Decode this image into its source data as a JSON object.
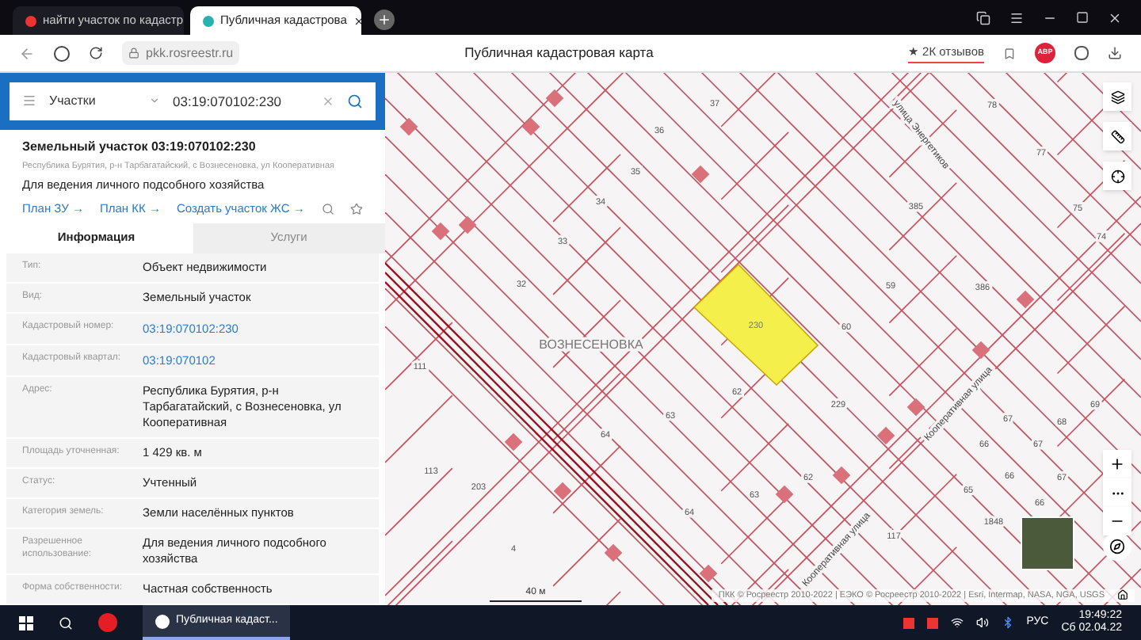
{
  "browser": {
    "tabs": [
      {
        "title": "найти участок по кадастр",
        "selected": false
      },
      {
        "title": "Публичная кадастрова",
        "selected": true
      }
    ],
    "url": "pkk.rosreestr.ru",
    "page_title": "Публичная кадастровая карта",
    "reviews": "★ 2К отзывов",
    "adblock": "ABP"
  },
  "search": {
    "category": "Участки",
    "value": "03:19:070102:230"
  },
  "object": {
    "title": "Земельный участок 03:19:070102:230",
    "address": "Республика Бурятия, р-н Тарбагатайский, с Вознесеновка, ул Кооперативная",
    "purpose": "Для ведения личного подсобного хозяйства",
    "links": [
      "План ЗУ →",
      "План КК →",
      "Создать участок ЖС →"
    ]
  },
  "info_tabs": [
    {
      "label": "Информация",
      "selected": true
    },
    {
      "label": "Услуги",
      "selected": false
    }
  ],
  "rows": [
    {
      "label": "Тип:",
      "value": "Объект недвижимости",
      "kind": "text"
    },
    {
      "label": "Вид:",
      "value": "Земельный участок",
      "kind": "text"
    },
    {
      "label": "Кадастровый номер:",
      "value": "03:19:070102:230",
      "kind": "link"
    },
    {
      "label": "Кадастровый квартал:",
      "value": "03:19:070102",
      "kind": "link"
    },
    {
      "label": "Адрес:",
      "value": "Республика Бурятия, р-н Тарбагатайский, с Вознесеновка, ул Кооперативная",
      "kind": "text"
    },
    {
      "label": "Площадь уточненная:",
      "value": "1 429 кв. м",
      "kind": "text"
    },
    {
      "label": "Статус:",
      "value": "Учтенный",
      "kind": "text"
    },
    {
      "label": "Категория земель:",
      "value": "Земли населённых пунктов",
      "kind": "text"
    },
    {
      "label": "Разрешенное использование:",
      "value": "Для ведения личного подсобного хозяйства",
      "kind": "text"
    },
    {
      "label": "Форма собственности:",
      "value": "Частная собственность",
      "kind": "text"
    }
  ],
  "map": {
    "village": "ВОЗНЕСЕНОВКА",
    "selected_parcel": "230",
    "parcels": [
      "37",
      "36",
      "35",
      "34",
      "33",
      "32",
      "385",
      "59",
      "386",
      "60",
      "62",
      "229",
      "63",
      "64",
      "111",
      "113",
      "203",
      "4",
      "63",
      "64",
      "62",
      "117",
      "78",
      "77",
      "75",
      "74",
      "69",
      "68",
      "67",
      "67",
      "66",
      "66",
      "67",
      "65",
      "66",
      "1848"
    ],
    "streets": [
      "улица Энергетиков",
      "Кооперативная улица",
      "Кооперативная улица"
    ],
    "scale": "40 м",
    "attribution": "ПКК © Росреестр 2010-2022 | ЕЭКО © Росреестр 2010-2022 | Esri, Intermap, NASA, NGA, USGS"
  },
  "taskbar": {
    "app": "Публичная кадаст...",
    "language": "РУС",
    "time": "19:49:22",
    "date": "Сб 02.04.22"
  }
}
